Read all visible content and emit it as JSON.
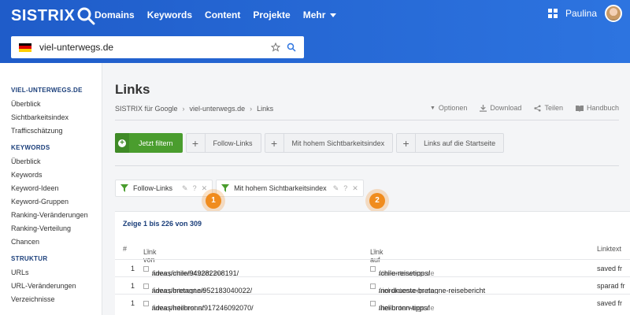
{
  "header": {
    "logo_text": "SISTRIX",
    "nav": [
      "Domains",
      "Keywords",
      "Content",
      "Projekte",
      "Mehr"
    ],
    "user_name": "Paulina",
    "search_value": "viel-unterwegs.de"
  },
  "sidebar": {
    "groups": [
      {
        "title": "VIEL-UNTERWEGS.DE",
        "items": [
          "Überblick",
          "Sichtbarkeitsindex",
          "Trafficschätzung"
        ]
      },
      {
        "title": "KEYWORDS",
        "items": [
          "Überblick",
          "Keywords",
          "Keyword-Ideen",
          "Keyword-Gruppen",
          "Ranking-Veränderungen",
          "Ranking-Verteilung",
          "Chancen"
        ]
      },
      {
        "title": "STRUKTUR",
        "items": [
          "URLs",
          "URL-Veränderungen",
          "Verzeichnisse"
        ]
      }
    ]
  },
  "page": {
    "title": "Links",
    "breadcrumb": [
      "SISTRIX für Google",
      "viel-unterwegs.de",
      "Links"
    ],
    "actions": [
      "Optionen",
      "Download",
      "Teilen",
      "Handbuch"
    ]
  },
  "filterbar": {
    "go_label": "Jetzt filtern",
    "buttons": [
      "Follow-Links",
      "Mit hohem Sichtbarkeitsindex",
      "Links auf die Startseite"
    ]
  },
  "active_filters": [
    {
      "label": "Follow-Links",
      "marker": "1"
    },
    {
      "label": "Mit hohem Sichtbarkeitsindex",
      "marker": "2"
    }
  ],
  "table": {
    "showing": "Zeige 1 bis 226 von 309",
    "headers": {
      "num": "#",
      "from": "Link von",
      "to": "Link auf",
      "text": "Linktext"
    },
    "rows": [
      {
        "num": "1",
        "src_domain": "www.pinterest.com.mx",
        "src_path": "/ideas/chile/949282208191/",
        "dst_domain": "viel-unterwegs.de",
        "dst_path": "/chile-reisetipps/",
        "text": "saved fr"
      },
      {
        "num": "1",
        "src_domain": "www.pinterest.se",
        "src_path": "/ideas/bretagne/952183040022/",
        "dst_domain": "viel-unterwegs.de",
        "dst_path": "/nordkueste-bretagne-reisebericht",
        "text": "sparad fr"
      },
      {
        "num": "1",
        "src_domain": "www.pinterest.at",
        "src_path": "/ideas/heilbronn/917246092070/",
        "dst_domain": "viel-unterwegs.de",
        "dst_path": "/heilbronn-tipps/",
        "text": "saved fr"
      }
    ]
  },
  "colors": {
    "header": "#1f5cc9",
    "accent_green": "#4a9d2e",
    "marker_orange": "#f08c1e",
    "title_blue": "#1a3e7a"
  }
}
